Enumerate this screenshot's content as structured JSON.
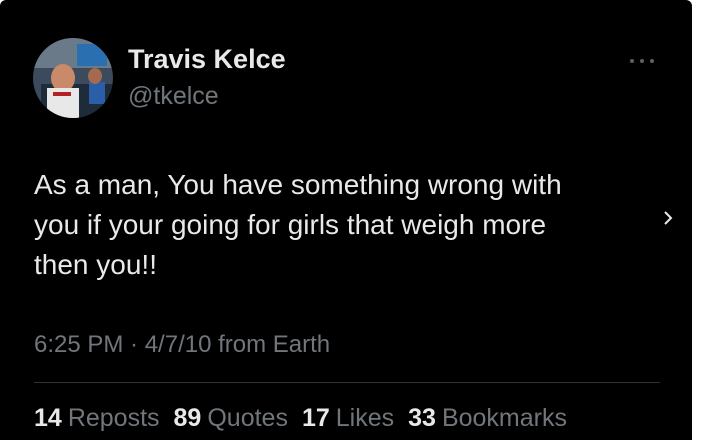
{
  "author": {
    "display_name": "Travis Kelce",
    "handle": "@tkelce",
    "avatar_icon": "profile-photo"
  },
  "tweet": {
    "lines": [
      "As a man, You have something wrong with",
      "you if your going for girls that weigh more",
      "then you!!"
    ],
    "timestamp": "6:25 PM · 4/7/10 from Earth"
  },
  "stats": [
    {
      "count": "14",
      "label": "Reposts"
    },
    {
      "count": "89",
      "label": "Quotes"
    },
    {
      "count": "17",
      "label": "Likes"
    },
    {
      "count": "33",
      "label": "Bookmarks"
    }
  ],
  "icons": {
    "more": "more-horizontal-icon",
    "next": "chevron-right-icon"
  },
  "colors": {
    "background": "#000000",
    "primary_text": "#e7e9ea",
    "secondary_text": "#71767b",
    "divider": "#2f3336"
  }
}
